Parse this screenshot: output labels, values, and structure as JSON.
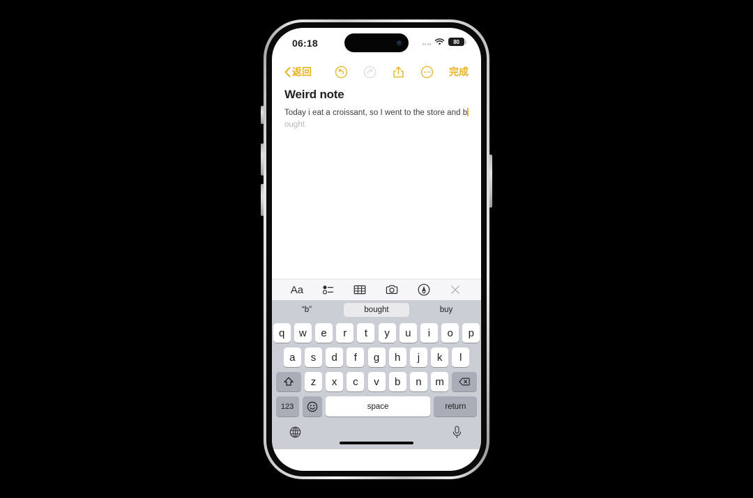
{
  "device": {
    "name": "iphone-15-pro"
  },
  "status_bar": {
    "time": "06:18",
    "battery_level": "80",
    "wifi_icon": "wifi-icon",
    "cellular_icon": "cellular-signal-icon",
    "battery_icon": "battery-icon"
  },
  "nav_bar": {
    "back_label": "返回",
    "back_icon": "chevron-left-icon",
    "undo_icon": "undo-icon",
    "redo_icon": "redo-icon",
    "share_icon": "share-icon",
    "more_icon": "more-circle-icon",
    "done_label": "完成",
    "accent_color": "#e8b222",
    "disabled_color": "#d8d8da"
  },
  "note": {
    "title": "Weird note",
    "body_typed": "Today i eat a croissant, so I went to the store and b",
    "body_prediction": "ought",
    "body_line1": "Today i eat a croissant, so I went to the store",
    "body_line2_typed": "and b",
    "caret_color": "#e8b222"
  },
  "format_toolbar": {
    "items": [
      {
        "name": "text-format-icon",
        "label": "Aa"
      },
      {
        "name": "checklist-icon",
        "label": ""
      },
      {
        "name": "table-icon",
        "label": ""
      },
      {
        "name": "camera-icon",
        "label": ""
      },
      {
        "name": "markup-pen-icon",
        "label": ""
      },
      {
        "name": "close-icon",
        "label": ""
      }
    ]
  },
  "predictive_bar": {
    "suggestions": [
      {
        "text": "“b”",
        "selected": false
      },
      {
        "text": "bought",
        "selected": true
      },
      {
        "text": "buy",
        "selected": false
      }
    ]
  },
  "keyboard": {
    "row1": [
      "q",
      "w",
      "e",
      "r",
      "t",
      "y",
      "u",
      "i",
      "o",
      "p"
    ],
    "row2": [
      "a",
      "s",
      "d",
      "f",
      "g",
      "h",
      "j",
      "k",
      "l"
    ],
    "row3": [
      "z",
      "x",
      "c",
      "v",
      "b",
      "n",
      "m"
    ],
    "shift_icon": "shift-icon",
    "backspace_icon": "backspace-icon",
    "numbers_label": "123",
    "emoji_icon": "emoji-icon",
    "space_label": "space",
    "return_label": "return",
    "globe_icon": "globe-icon",
    "mic_icon": "microphone-icon",
    "key_bg": "#ffffff",
    "fn_key_bg": "#a9adb8",
    "keyboard_bg": "#cbced5"
  }
}
